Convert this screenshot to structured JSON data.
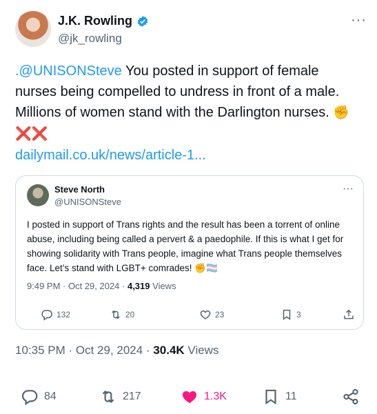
{
  "author": {
    "name": "J.K. Rowling",
    "handle": "@jk_rowling",
    "more": "···"
  },
  "tweet": {
    "mention": ".@UNISONSteve",
    "text": " You posted in support of female nurses being compelled to undress in front of a male. Millions of women stand with the Darlington nurses. ",
    "emojis": "✊❌❌",
    "link": "dailymail.co.uk/news/article-1..."
  },
  "quote": {
    "name": "Steve North",
    "handle": "@UNISONSteve",
    "more": "···",
    "text": "I posted in support of Trans rights and the result has been a torrent of online abuse, including being called a pervert & a paedophile. If this is what I get for showing solidarity with Trans people, imagine what Trans people themselves face. Let’s stand with LGBT+ comrades! ✊🏳️‍⚧️",
    "time": "9:49 PM · Oct 29, 2024 · ",
    "views_count": "4,319",
    "views_label": " Views",
    "replies": "132",
    "reposts": "20",
    "likes": "23",
    "bookmarks": "3"
  },
  "timestamp": {
    "time": "10:35 PM · Oct 29, 2024 · ",
    "views_count": "30.4K",
    "views_label": " Views"
  },
  "actions": {
    "replies": "84",
    "reposts": "217",
    "likes": "1.3K",
    "bookmarks": "11"
  },
  "colors": {
    "accent": "#1d9bf0",
    "like": "#f91880",
    "muted": "#536471"
  }
}
